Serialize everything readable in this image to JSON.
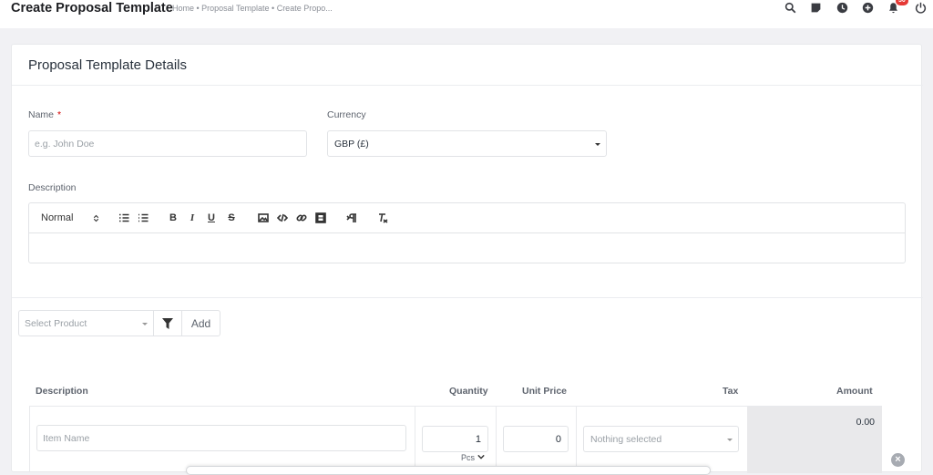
{
  "header": {
    "title": "Create Proposal Template",
    "breadcrumb": "Home • Proposal Template • Create Propo...",
    "notification_count": "30"
  },
  "icons": [
    "search-icon",
    "sticky-note-icon",
    "clock-icon",
    "plus-circle-icon",
    "bell-icon",
    "power-icon"
  ],
  "card": {
    "title": "Proposal Template Details"
  },
  "form": {
    "name_label": "Name",
    "name_required": "*",
    "name_placeholder": "e.g. John Doe",
    "currency_label": "Currency",
    "currency_value": "GBP (£)",
    "description_label": "Description",
    "editor_format": "Normal"
  },
  "product": {
    "select_placeholder": "Select Product",
    "add_label": "Add"
  },
  "table": {
    "headers": {
      "description": "Description",
      "quantity": "Quantity",
      "unit_price": "Unit Price",
      "tax": "Tax",
      "amount": "Amount"
    },
    "row": {
      "item_placeholder": "Item Name",
      "quantity": "1",
      "unit": "Pcs",
      "unit_price": "0",
      "tax_placeholder": "Nothing selected",
      "amount": "0.00"
    }
  },
  "colors": {
    "accent": "#1d82f5",
    "required": "#d30000",
    "badge": "#e53935"
  }
}
